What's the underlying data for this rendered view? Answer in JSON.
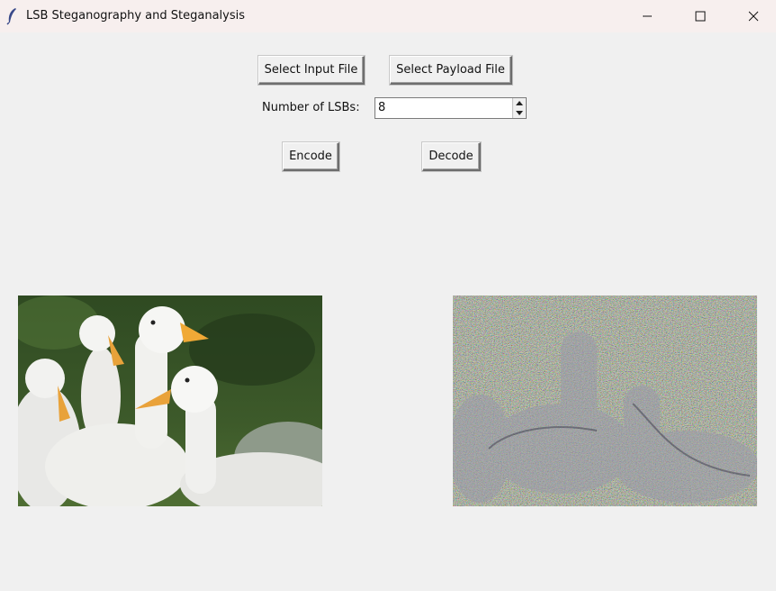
{
  "window": {
    "title": "LSB Steganography and Steganalysis"
  },
  "toolbar": {
    "select_input_label": "Select Input File",
    "select_payload_label": "Select Payload File"
  },
  "lsb": {
    "label": "Number of LSBs:",
    "value": "8"
  },
  "actions": {
    "encode_label": "Encode",
    "decode_label": "Decode"
  },
  "images": {
    "cover": {
      "icon": "cover-image",
      "subject": "white ducks photo"
    },
    "stego": {
      "icon": "stego-image",
      "subject": "noisy decoded ducks image"
    }
  }
}
